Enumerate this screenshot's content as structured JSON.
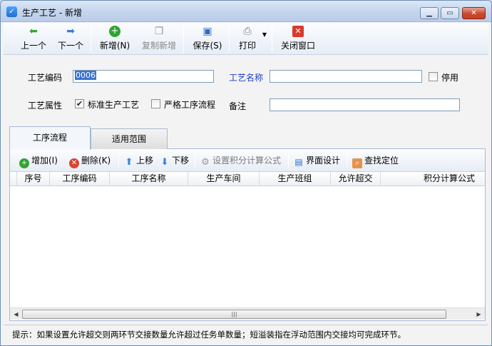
{
  "window": {
    "title": "生产工艺 - 新增"
  },
  "toolbar": {
    "prev": "上一个",
    "next": "下一个",
    "new": "新增(N)",
    "copy_new": "复制新增",
    "save": "保存(S)",
    "print": "打印",
    "close_window": "关闭窗口"
  },
  "form": {
    "code_label": "工艺编码",
    "code_value": "0006",
    "name_label": "工艺名称",
    "name_value": "",
    "disabled_label": "停用",
    "disabled_checked": false,
    "attr_label": "工艺属性",
    "standard_label": "标准生产工艺",
    "standard_checked": true,
    "strict_label": "严格工序流程",
    "strict_checked": false,
    "remark_label": "备注",
    "remark_value": ""
  },
  "tabs": [
    {
      "label": "工序流程",
      "active": true
    },
    {
      "label": "适用范围",
      "active": false
    }
  ],
  "grid_toolbar": {
    "add": "增加(I)",
    "delete": "删除(K)",
    "up": "上移",
    "down": "下移",
    "set_formula": "设置积分计算公式",
    "ui_design": "界面设计",
    "find": "查找定位"
  },
  "grid": {
    "columns": [
      "序号",
      "工序编码",
      "工序名称",
      "生产车间",
      "生产班组",
      "允许超交",
      "积分计算公式"
    ]
  },
  "status": {
    "text": "提示：如果设置允许超交则两环节交接数量允许超过任务单数量；短溢装指在浮动范围内交接均可完成环节。"
  },
  "colors": {
    "title_gradient": "#c5d6ee",
    "label_blue": "#1a3cc7",
    "close_red": "#c9482e"
  }
}
